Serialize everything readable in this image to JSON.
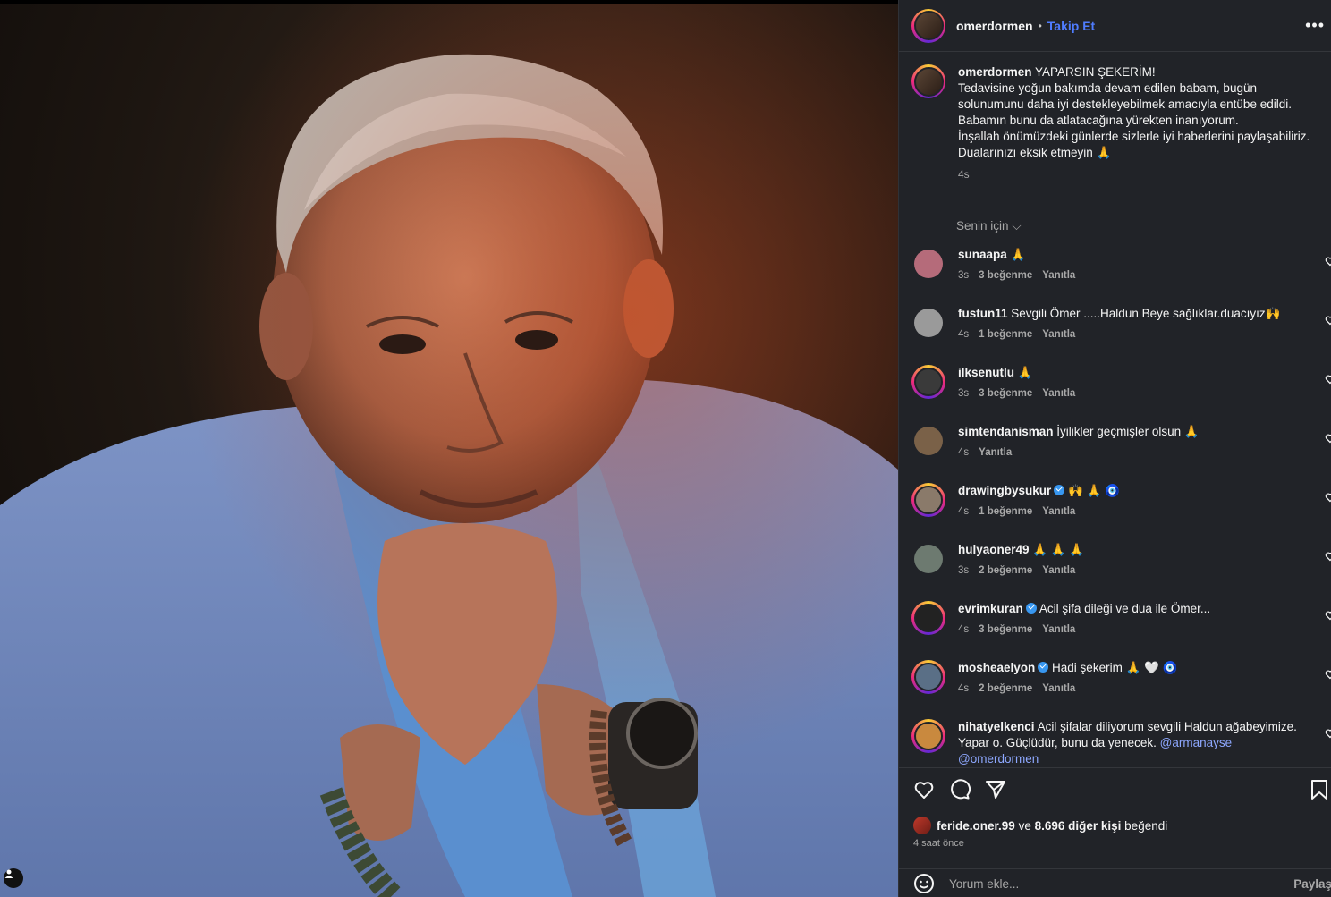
{
  "post": {
    "author": "omerdormen",
    "follow_label": "Takip Et",
    "header_separator": "•",
    "more_icon": "more-horizontal-icon"
  },
  "caption": {
    "author": "omerdormen",
    "lines": [
      "YAPARSIN ŞEKERİM!",
      "Tedavisine yoğun bakımda devam edilen babam, bugün solunumunu daha iyi destekleyebilmek amacıyla entübe edildi.",
      "Babamın bunu da atlatacağına yürekten inanıyorum.",
      "İnşallah önümüzdeki günlerde sizlerle iyi haberlerini paylaşabiliriz.",
      "Dualarınızı eksik etmeyin 🙏"
    ],
    "time": "4s"
  },
  "filter_label": "Senin için",
  "comments": [
    {
      "user": "sunaapa",
      "verified": false,
      "text": "🙏",
      "time": "3s",
      "likes": "3 beğenme",
      "reply": "Yanıtla",
      "avatar": "#b56b7a",
      "ring": false
    },
    {
      "user": "fustun11",
      "verified": false,
      "text": "Sevgili Ömer .....Haldun Beye sağlıklar.duacıyız🙌",
      "time": "4s",
      "likes": "1 beğenme",
      "reply": "Yanıtla",
      "avatar": "#9a9a9a",
      "ring": false
    },
    {
      "user": "ilksenutlu",
      "verified": false,
      "text": "🙏",
      "time": "3s",
      "likes": "3 beğenme",
      "reply": "Yanıtla",
      "avatar": "#3a3a3a",
      "ring": true
    },
    {
      "user": "simtendanisman",
      "verified": false,
      "text": "İyilikler geçmişler olsun 🙏",
      "time": "4s",
      "likes": "",
      "reply": "Yanıtla",
      "avatar": "#7a6148",
      "ring": false
    },
    {
      "user": "drawingbysukur",
      "verified": true,
      "text": "🙌 🙏 🧿",
      "time": "4s",
      "likes": "1 beğenme",
      "reply": "Yanıtla",
      "avatar": "#8a7a6a",
      "ring": true
    },
    {
      "user": "hulyaoner49",
      "verified": false,
      "text": "🙏 🙏 🙏",
      "time": "3s",
      "likes": "2 beğenme",
      "reply": "Yanıtla",
      "avatar": "#6d7a70",
      "ring": false
    },
    {
      "user": "evrimkuran",
      "verified": true,
      "text": "Acil şifa dileği ve dua ile Ömer...",
      "time": "4s",
      "likes": "3 beğenme",
      "reply": "Yanıtla",
      "avatar": "#222222",
      "ring": true
    },
    {
      "user": "mosheaelyon",
      "verified": true,
      "text": "Hadi şekerim 🙏 🤍 🧿",
      "time": "4s",
      "likes": "2 beğenme",
      "reply": "Yanıtla",
      "avatar": "#5a6f86",
      "ring": true
    },
    {
      "user": "nihatyelkenci",
      "verified": false,
      "text": "Acil şifalar diliyorum sevgili Haldun ağabeyimize. Yapar o. Güçlüdür, bunu da yenecek.",
      "mentions": [
        "@armanayse",
        "@omerdormen"
      ],
      "time": "",
      "likes": "",
      "reply": "",
      "avatar": "#c9893e",
      "ring": true
    }
  ],
  "likes": {
    "user": "feride.oner.99",
    "joiner": "ve",
    "others": "8.696 diğer kişi",
    "suffix": "beğendi"
  },
  "posted_ago": "4 saat önce",
  "comment_box": {
    "placeholder": "Yorum ekle...",
    "post_label": "Paylaş"
  },
  "icons": [
    "like-icon",
    "comment-icon",
    "share-icon",
    "save-icon",
    "emoji-icon",
    "user-tag-icon"
  ],
  "colors": {
    "panel_bg": "#212328",
    "accent": "#4f7cff",
    "muted": "#a8a8a8"
  }
}
